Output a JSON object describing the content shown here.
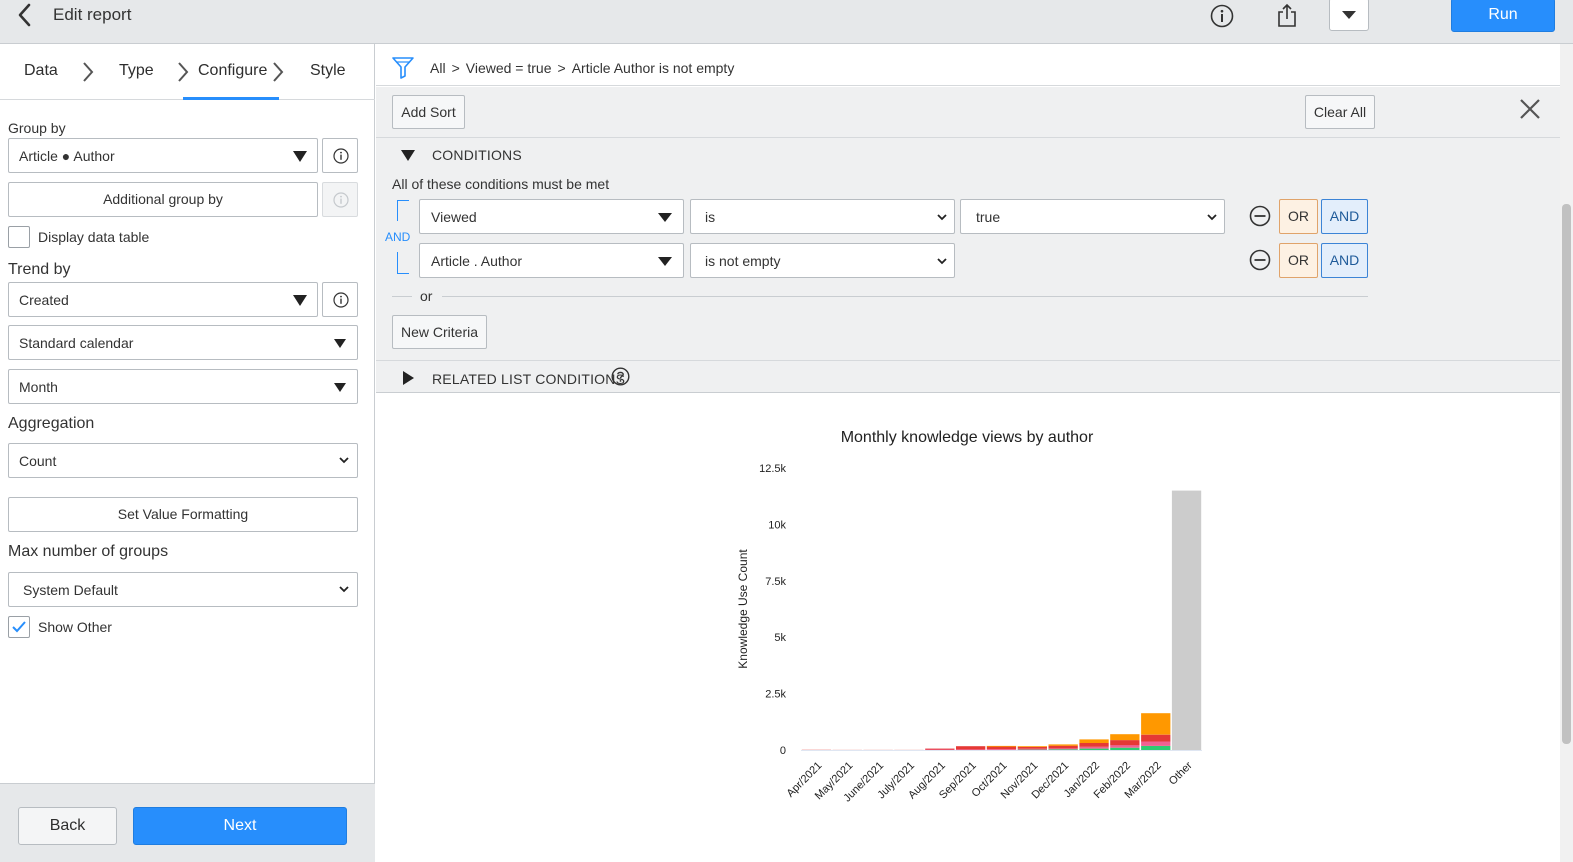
{
  "header": {
    "title": "Edit report",
    "run_label": "Run"
  },
  "steps": [
    "Data",
    "Type",
    "Configure",
    "Style"
  ],
  "configure": {
    "group_by_label": "Group by",
    "group_by_value": "Article ● Author",
    "additional_group_by": "Additional group by",
    "display_data_table": "Display data table",
    "trend_by_label": "Trend by",
    "trend_by_value": "Created",
    "calendar_value": "Standard calendar",
    "interval_value": "Month",
    "aggregation_label": "Aggregation",
    "aggregation_value": "Count",
    "set_value_formatting": "Set Value Formatting",
    "max_groups_label": "Max number of groups",
    "max_groups_value": "System Default",
    "show_other": "Show Other",
    "show_other_checked": true,
    "display_data_table_checked": false
  },
  "footer": {
    "back_label": "Back",
    "next_label": "Next"
  },
  "breadcrumb": [
    "All",
    "Viewed = true",
    "Article Author is not empty"
  ],
  "filter": {
    "add_sort": "Add Sort",
    "clear_all": "Clear All",
    "conditions_title": "CONDITIONS",
    "conditions_hint": "All of these conditions must be met",
    "and_connector": "AND",
    "rows": [
      {
        "field": "Viewed",
        "operator": "is",
        "value": "true"
      },
      {
        "field": "Article . Author",
        "operator": "is not empty",
        "value": ""
      }
    ],
    "or_label": "OR",
    "and_label": "AND",
    "or_separator": "or",
    "new_criteria": "New Criteria",
    "related_list_title": "RELATED LIST CONDITIONS"
  },
  "chart_data": {
    "type": "bar",
    "stacked": true,
    "title": "Monthly knowledge views by author",
    "ylabel": "Knowledge Use Count",
    "xlabel": "",
    "ylim": [
      0,
      12500
    ],
    "yticks": [
      "0",
      "2.5k",
      "5k",
      "7.5k",
      "10k",
      "12.5k"
    ],
    "ytick_values": [
      0,
      2500,
      5000,
      7500,
      10000,
      12500
    ],
    "categories": [
      "Apr/2021",
      "May/2021",
      "June/2021",
      "July/2021",
      "Aug/2021",
      "Sep/2021",
      "Oct/2021",
      "Nov/2021",
      "Dec/2021",
      "Jan/2022",
      "Feb/2022",
      "Mar/2022",
      "Other"
    ],
    "series": [
      {
        "color": "#2ecc71",
        "values": [
          0,
          0,
          0,
          0,
          0,
          0,
          0,
          20,
          30,
          60,
          100,
          180,
          0
        ]
      },
      {
        "color": "#f06292",
        "values": [
          0,
          0,
          0,
          0,
          20,
          30,
          40,
          30,
          40,
          80,
          120,
          200,
          0
        ]
      },
      {
        "color": "#e53935",
        "values": [
          10,
          5,
          5,
          5,
          40,
          140,
          120,
          90,
          120,
          170,
          220,
          300,
          0
        ]
      },
      {
        "color": "#ff9800",
        "values": [
          0,
          0,
          0,
          0,
          0,
          0,
          20,
          30,
          60,
          160,
          260,
          950,
          0
        ]
      },
      {
        "color": "#cccccc",
        "values": [
          0,
          0,
          0,
          0,
          0,
          0,
          0,
          0,
          0,
          0,
          0,
          0,
          11500
        ]
      }
    ],
    "grid": false,
    "legend": "none"
  },
  "colors": {
    "primary": "#278efc",
    "or_button": "#fdf1e3",
    "and_button": "#e3eefb"
  }
}
